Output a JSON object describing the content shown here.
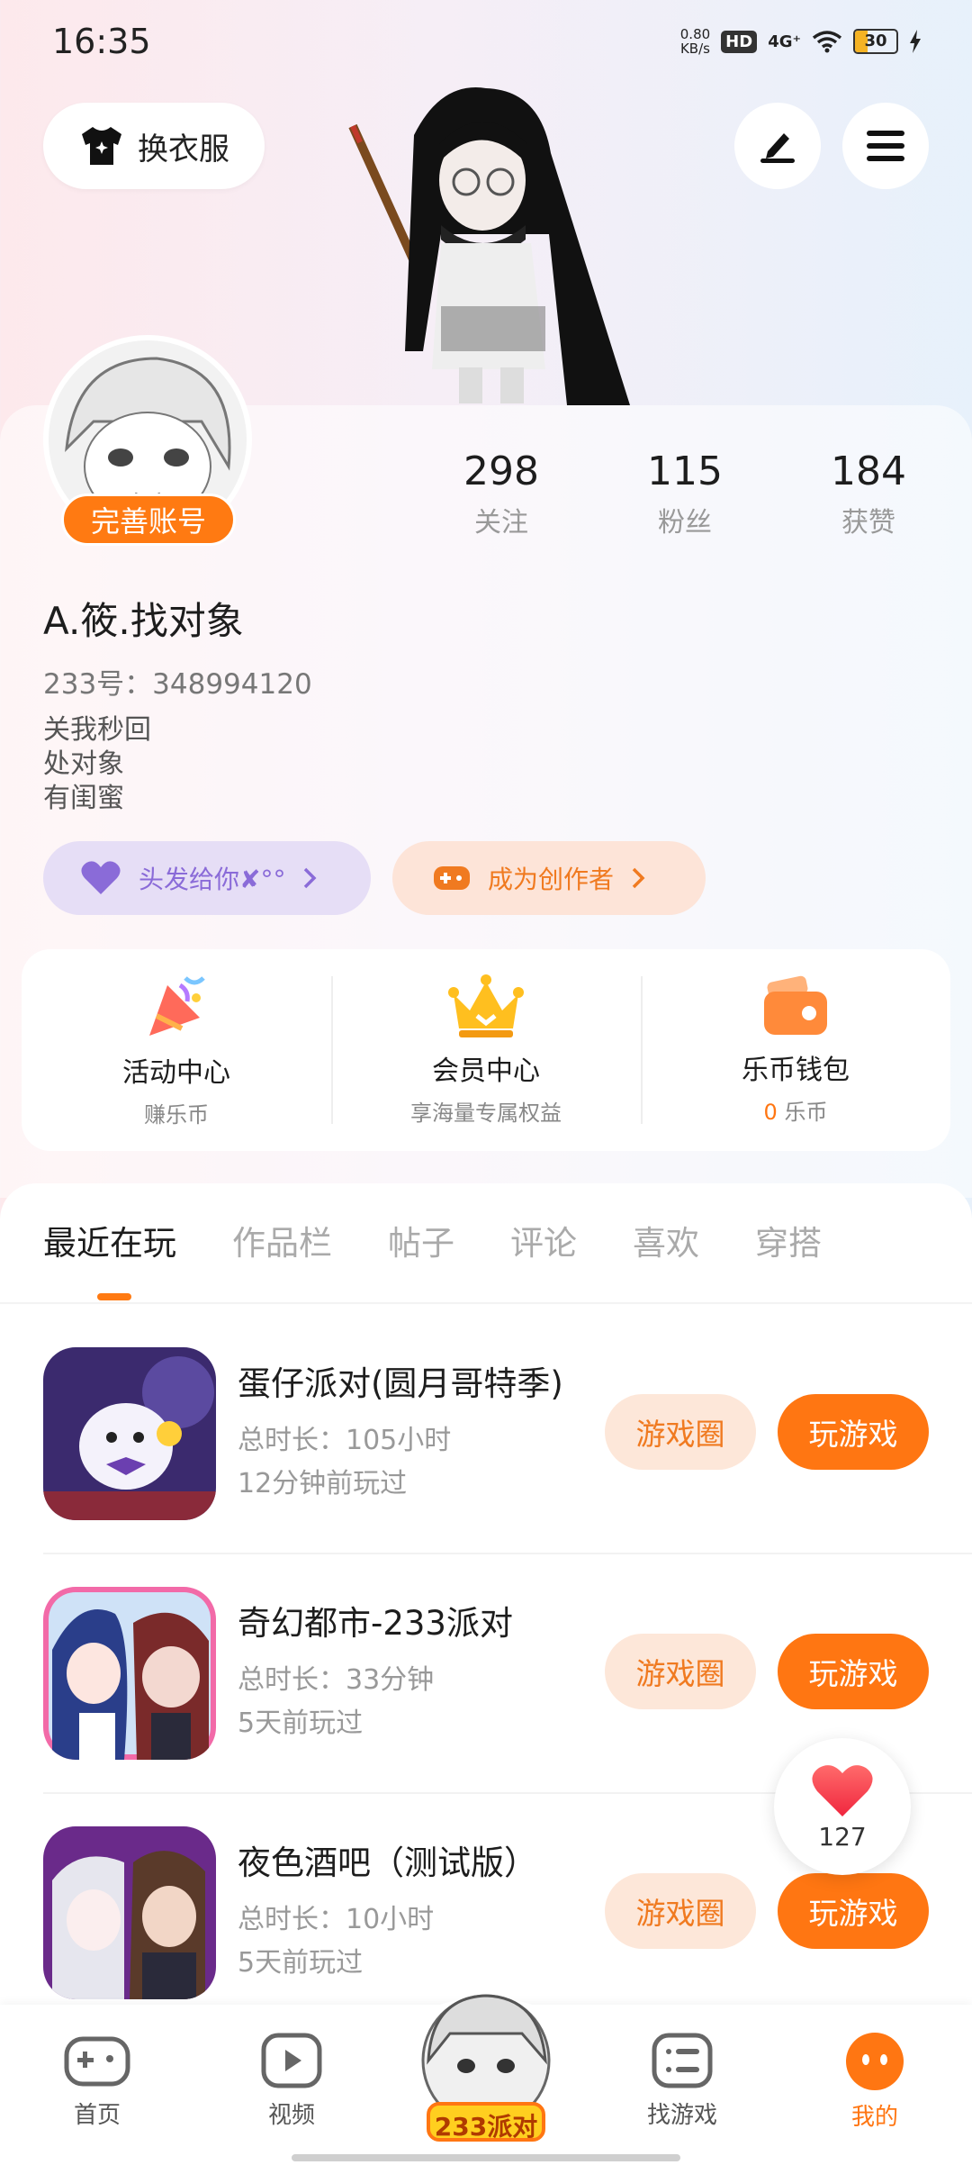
{
  "status": {
    "time": "16:35",
    "net_speed": "0.80",
    "net_unit": "KB/s",
    "hd": "HD",
    "signal": "4G⁺",
    "battery": "30",
    "battery_level": 0.3
  },
  "top": {
    "outfit_label": "换衣服"
  },
  "profile": {
    "complete_account_label": "完善账号",
    "stats": [
      {
        "num": "298",
        "label": "关注"
      },
      {
        "num": "115",
        "label": "粉丝"
      },
      {
        "num": "184",
        "label": "获赞"
      }
    ],
    "nickname": "A.筱.找对象",
    "uid": "233号：348994120",
    "bio": [
      "关我秒回",
      "处对象",
      "有闺蜜"
    ],
    "tag_hair": "头发给你✘°°",
    "tag_creator": "成为创作者"
  },
  "services": [
    {
      "title": "活动中心",
      "sub": "赚乐币",
      "icon": "party-popper-icon"
    },
    {
      "title": "会员中心",
      "sub": "享海量专属权益",
      "icon": "crown-icon"
    },
    {
      "title": "乐币钱包",
      "sub_num": "0",
      "sub": " 乐币",
      "icon": "wallet-icon"
    }
  ],
  "tabs": [
    "最近在玩",
    "作品栏",
    "帖子",
    "评论",
    "喜欢",
    "穿搭"
  ],
  "games": [
    {
      "name": "蛋仔派对(圆月哥特季)",
      "duration": "总时长：105小时",
      "last": "12分钟前玩过",
      "circle": "游戏圈",
      "play": "玩游戏"
    },
    {
      "name": "奇幻都市-233派对",
      "duration": "总时长：33分钟",
      "last": "5天前玩过",
      "circle": "游戏圈",
      "play": "玩游戏"
    },
    {
      "name": "夜色酒吧（测试版）",
      "duration": "总时长：10小时",
      "last": "5天前玩过",
      "circle": "游戏圈",
      "play": "玩游戏"
    }
  ],
  "like_count": "127",
  "nav": [
    {
      "label": "首页",
      "icon": "gamepad-icon"
    },
    {
      "label": "视频",
      "icon": "video-icon"
    },
    {
      "label": "233派对",
      "icon": "party-logo"
    },
    {
      "label": "找游戏",
      "icon": "list-icon"
    },
    {
      "label": "我的",
      "icon": "profile-face-icon"
    }
  ],
  "colors": {
    "accent": "#ff7612",
    "accent_light": "#fde7d9",
    "purple_tag": "#8a6bd8"
  }
}
